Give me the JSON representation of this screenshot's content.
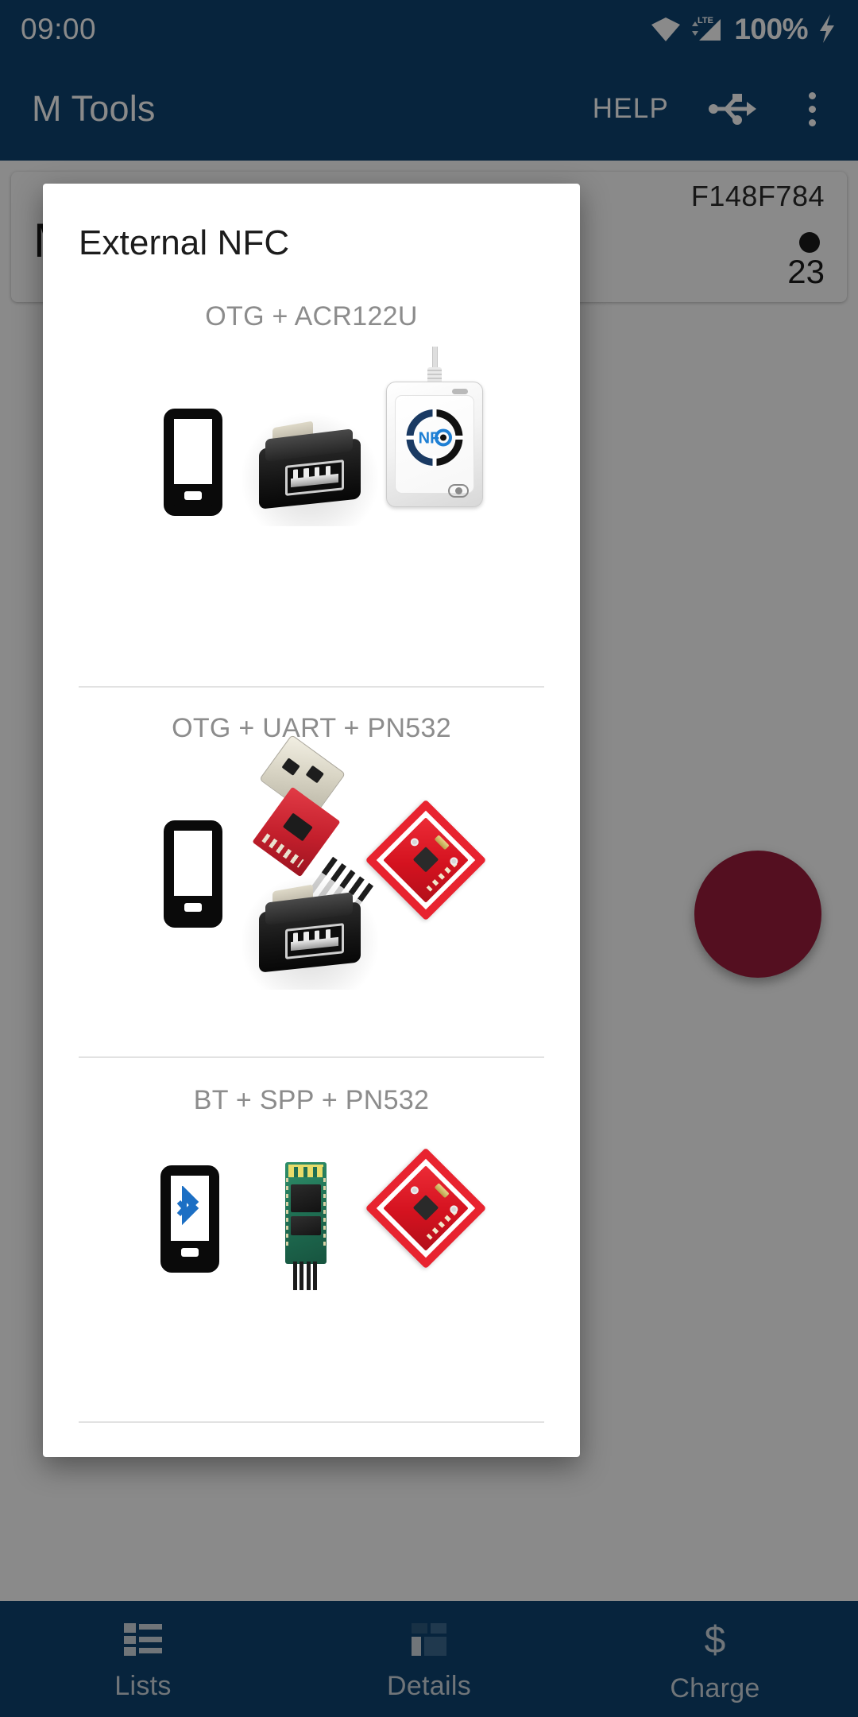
{
  "status_bar": {
    "clock": "09:00",
    "battery_percent": "100%",
    "network_type": "LTE",
    "icons": [
      "wifi-icon",
      "lte-signal-icon",
      "battery-charging-icon"
    ]
  },
  "app_bar": {
    "title": "M Tools",
    "help_label": "HELP",
    "usb_icon": "usb-icon",
    "overflow_icon": "overflow-menu-icon"
  },
  "background_card": {
    "uid": "F148F784",
    "name": "Metro",
    "count": "23"
  },
  "dialog": {
    "title": "External NFC",
    "sections": [
      {
        "label": "OTG + ACR122U",
        "devices": [
          "phone",
          "otg-adapter",
          "acr122u-reader"
        ]
      },
      {
        "label": "OTG + UART + PN532",
        "devices": [
          "phone",
          "usb-uart-adapter",
          "otg-adapter",
          "pn532-board"
        ]
      },
      {
        "label": "BT + SPP + PN532",
        "devices": [
          "phone-bluetooth",
          "hc05-module",
          "pn532-board"
        ]
      }
    ],
    "reader_brand": "NFC"
  },
  "bottom_nav": {
    "items": [
      {
        "label": "Lists",
        "icon": "list-icon"
      },
      {
        "label": "Details",
        "icon": "dashboard-icon"
      },
      {
        "label": "Charge",
        "icon": "dollar-icon"
      }
    ]
  },
  "colors": {
    "primary": "#0d4371",
    "fab": "#9c1c3c",
    "dialog_bg": "#ffffff",
    "label_gray": "#8c8c8c",
    "divider": "#e2e2e2",
    "board_red": "#d4121f",
    "bluetooth_blue": "#1c6fc4"
  }
}
